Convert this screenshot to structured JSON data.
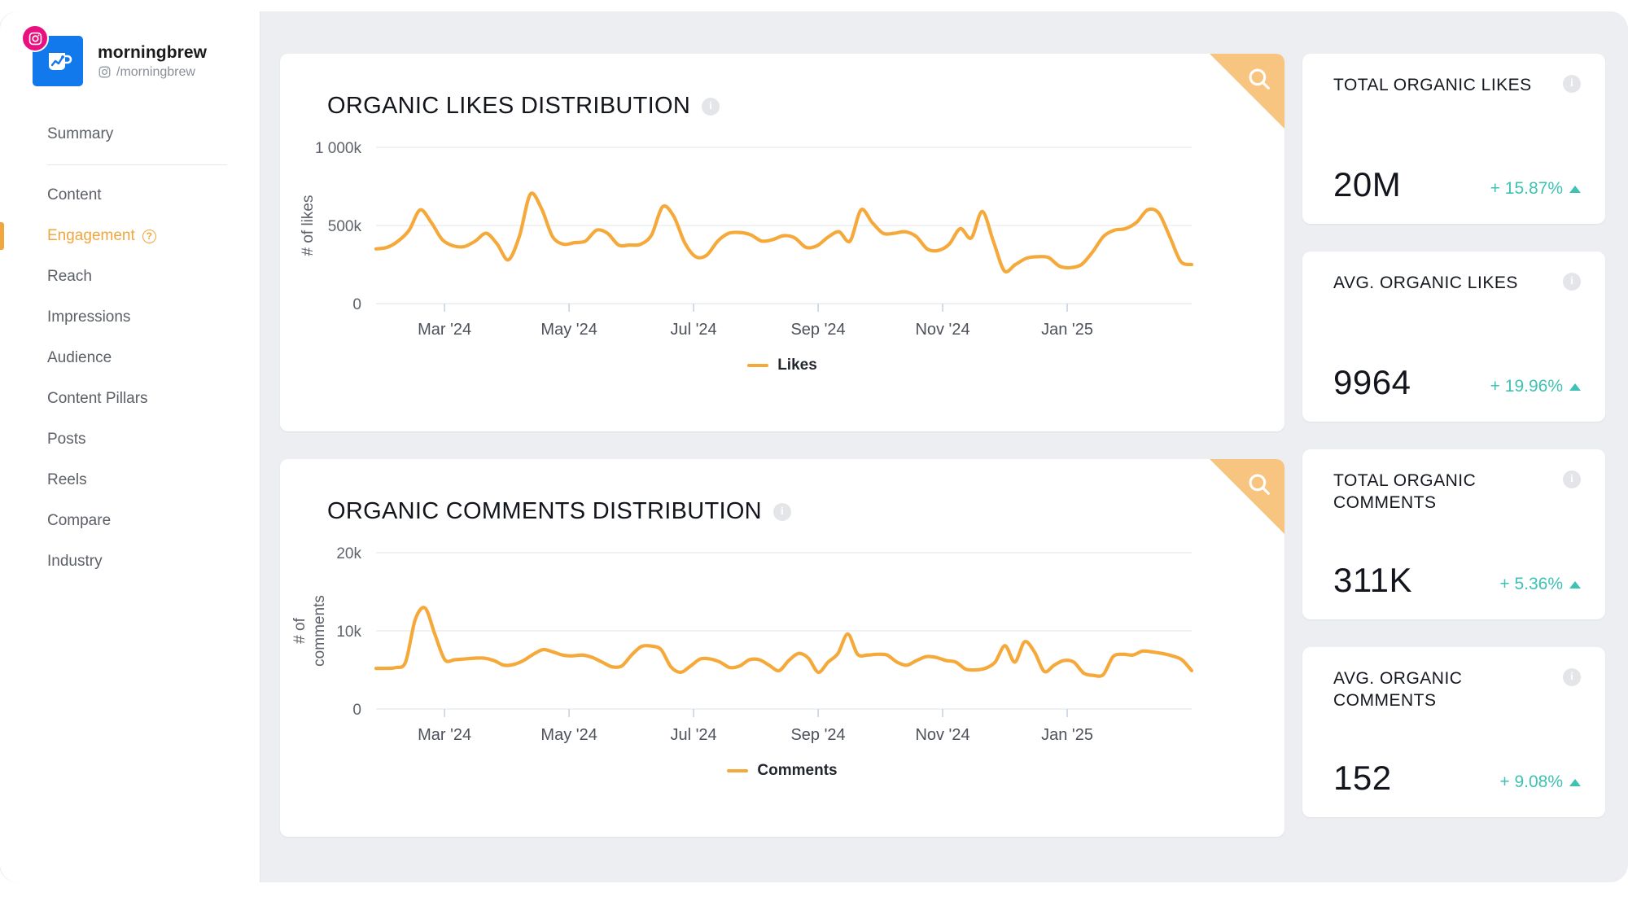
{
  "profile": {
    "name": "morningbrew",
    "handle": "/morningbrew",
    "network_icon": "instagram-icon",
    "avatar_icon": "mug-chart-logo-icon"
  },
  "sidebar": {
    "items": [
      {
        "label": "Summary",
        "active": false
      },
      {
        "label": "Content",
        "active": false
      },
      {
        "label": "Engagement",
        "active": true,
        "help_icon": "question-mark-icon"
      },
      {
        "label": "Reach",
        "active": false
      },
      {
        "label": "Impressions",
        "active": false
      },
      {
        "label": "Audience",
        "active": false
      },
      {
        "label": "Content Pillars",
        "active": false
      },
      {
        "label": "Posts",
        "active": false
      },
      {
        "label": "Reels",
        "active": false
      },
      {
        "label": "Compare",
        "active": false
      },
      {
        "label": "Industry",
        "active": false
      }
    ]
  },
  "colors": {
    "accent_orange": "#f5a93a",
    "corner_orange": "#f8c580",
    "positive_teal": "#3fc2b4",
    "brand_blue": "#1279ec",
    "instagram_pink": "#e8117f",
    "canvas_gray": "#eceef1"
  },
  "charts": [
    {
      "title": "ORGANIC LIKES DISTRIBUTION",
      "info_icon": "info-icon",
      "zoom_icon": "magnifier-icon",
      "legend": "Likes"
    },
    {
      "title": "ORGANIC COMMENTS DISTRIBUTION",
      "info_icon": "info-icon",
      "zoom_icon": "magnifier-icon",
      "legend": "Comments"
    }
  ],
  "kpis": [
    {
      "label": "TOTAL ORGANIC LIKES",
      "value": "20M",
      "delta": "+ 15.87%",
      "direction": "up",
      "info_icon": "info-icon"
    },
    {
      "label": "AVG. ORGANIC LIKES",
      "value": "9964",
      "delta": "+ 19.96%",
      "direction": "up",
      "info_icon": "info-icon"
    },
    {
      "label": "TOTAL ORGANIC COMMENTS",
      "value": "311K",
      "delta": "+ 5.36%",
      "direction": "up",
      "info_icon": "info-icon"
    },
    {
      "label": "AVG. ORGANIC COMMENTS",
      "value": "152",
      "delta": "+ 9.08%",
      "direction": "up",
      "info_icon": "info-icon"
    }
  ],
  "chart_data": [
    {
      "type": "line",
      "title": "ORGANIC LIKES DISTRIBUTION",
      "xlabel": "",
      "ylabel": "# of likes",
      "ylim": [
        0,
        1000000
      ],
      "ytick_labels": [
        "0",
        "500k",
        "1 000k"
      ],
      "ytick_values": [
        0,
        500000,
        1000000
      ],
      "xtick_labels": [
        "Mar '24",
        "May '24",
        "Jul '24",
        "Sep '24",
        "Nov '24",
        "Jan '25"
      ],
      "grid": true,
      "legend": [
        "Likes"
      ],
      "legend_position": "bottom-center",
      "series": [
        {
          "name": "Likes",
          "color": "#f5a93a",
          "values": [
            350000,
            360000,
            400000,
            470000,
            600000,
            520000,
            410000,
            370000,
            365000,
            400000,
            450000,
            380000,
            280000,
            430000,
            700000,
            610000,
            430000,
            380000,
            390000,
            400000,
            470000,
            450000,
            375000,
            375000,
            380000,
            440000,
            620000,
            560000,
            390000,
            300000,
            310000,
            400000,
            450000,
            455000,
            440000,
            400000,
            410000,
            435000,
            420000,
            360000,
            370000,
            425000,
            460000,
            400000,
            600000,
            520000,
            450000,
            450000,
            460000,
            430000,
            350000,
            340000,
            380000,
            480000,
            420000,
            590000,
            400000,
            210000,
            250000,
            290000,
            300000,
            295000,
            240000,
            230000,
            250000,
            330000,
            430000,
            470000,
            480000,
            520000,
            600000,
            580000,
            430000,
            270000,
            250000
          ]
        }
      ]
    },
    {
      "type": "line",
      "title": "ORGANIC COMMENTS DISTRIBUTION",
      "xlabel": "",
      "ylabel": "# of comments",
      "ylim": [
        0,
        20000
      ],
      "ytick_labels": [
        "0",
        "10k",
        "20k"
      ],
      "ytick_values": [
        0,
        10000,
        20000
      ],
      "xtick_labels": [
        "Mar '24",
        "May '24",
        "Jul '24",
        "Sep '24",
        "Nov '24",
        "Jan '25"
      ],
      "grid": true,
      "legend": [
        "Comments"
      ],
      "legend_position": "bottom-center",
      "series": [
        {
          "name": "Comments",
          "color": "#f5a93a",
          "values": [
            5200,
            5200,
            5300,
            6000,
            11500,
            12900,
            9500,
            6300,
            6300,
            6400,
            6500,
            6500,
            6200,
            5600,
            5700,
            6200,
            7000,
            7600,
            7300,
            6900,
            6800,
            6900,
            6600,
            6000,
            5400,
            5500,
            6900,
            8000,
            8050,
            7600,
            5400,
            4700,
            5500,
            6400,
            6400,
            6000,
            5300,
            5500,
            6300,
            6300,
            5600,
            4900,
            6200,
            7100,
            6500,
            4700,
            6000,
            7100,
            9600,
            7000,
            6900,
            7000,
            6900,
            6000,
            5600,
            6200,
            6700,
            6600,
            6200,
            6000,
            5100,
            5000,
            5200,
            6000,
            8100,
            6000,
            8600,
            7300,
            4800,
            5600,
            6200,
            6000,
            4600,
            4300,
            4400,
            6700,
            7000,
            6900,
            7400,
            7300,
            7100,
            6800,
            6300,
            4900
          ]
        }
      ]
    }
  ]
}
